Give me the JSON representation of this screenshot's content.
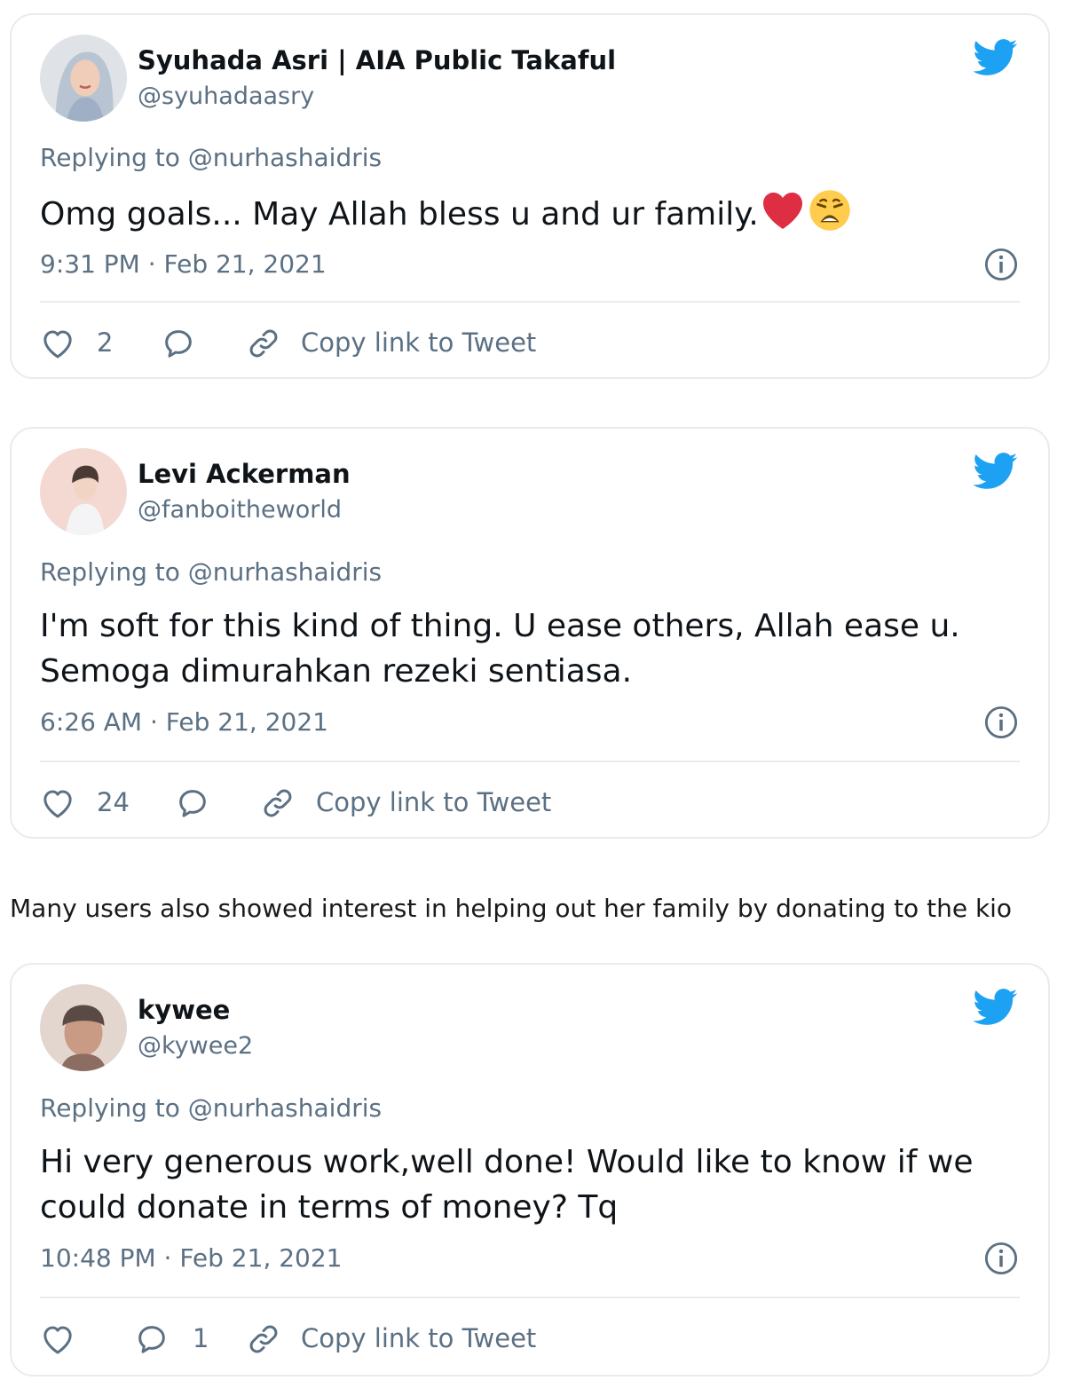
{
  "colors": {
    "twitter_blue": "#1da1f2",
    "muted": "#5b7083",
    "border": "#e6ecf0",
    "text": "#0f1419"
  },
  "caption": "Many users also showed interest in helping out her family by donating to the kio",
  "tweets": [
    {
      "name": "Syuhada Asri | AIA Public Takaful",
      "handle": "@syuhadaasry",
      "replying": "Replying to @nurhashaidris",
      "lines": [
        "Omg goals... May Allah bless u and ur family."
      ],
      "emojis": [
        "red-heart",
        "weary-face"
      ],
      "time": "9:31 PM · Feb 21, 2021",
      "likes": "2",
      "replies": "",
      "copy_link": "Copy link to Tweet"
    },
    {
      "name": "Levi Ackerman",
      "handle": "@fanboitheworld",
      "replying": "Replying to @nurhashaidris",
      "lines": [
        "I'm soft for this kind of thing. U ease others, Allah ease u.",
        "Semoga dimurahkan rezeki sentiasa."
      ],
      "time": "6:26 AM · Feb 21, 2021",
      "likes": "24",
      "replies": "",
      "copy_link": "Copy link to Tweet"
    },
    {
      "name": "kywee",
      "handle": "@kywee2",
      "replying": "Replying to @nurhashaidris",
      "lines": [
        "Hi very generous work,well done! Would like to know if we",
        "could donate in terms of money? Tq"
      ],
      "time": "10:48 PM · Feb 21, 2021",
      "likes": "",
      "replies": "1",
      "copy_link": "Copy link to Tweet"
    }
  ],
  "icons": {
    "brand": "twitter-bird-icon",
    "info": "info-icon",
    "like": "heart-outline-icon",
    "reply": "reply-bubble-icon",
    "link": "link-icon"
  }
}
